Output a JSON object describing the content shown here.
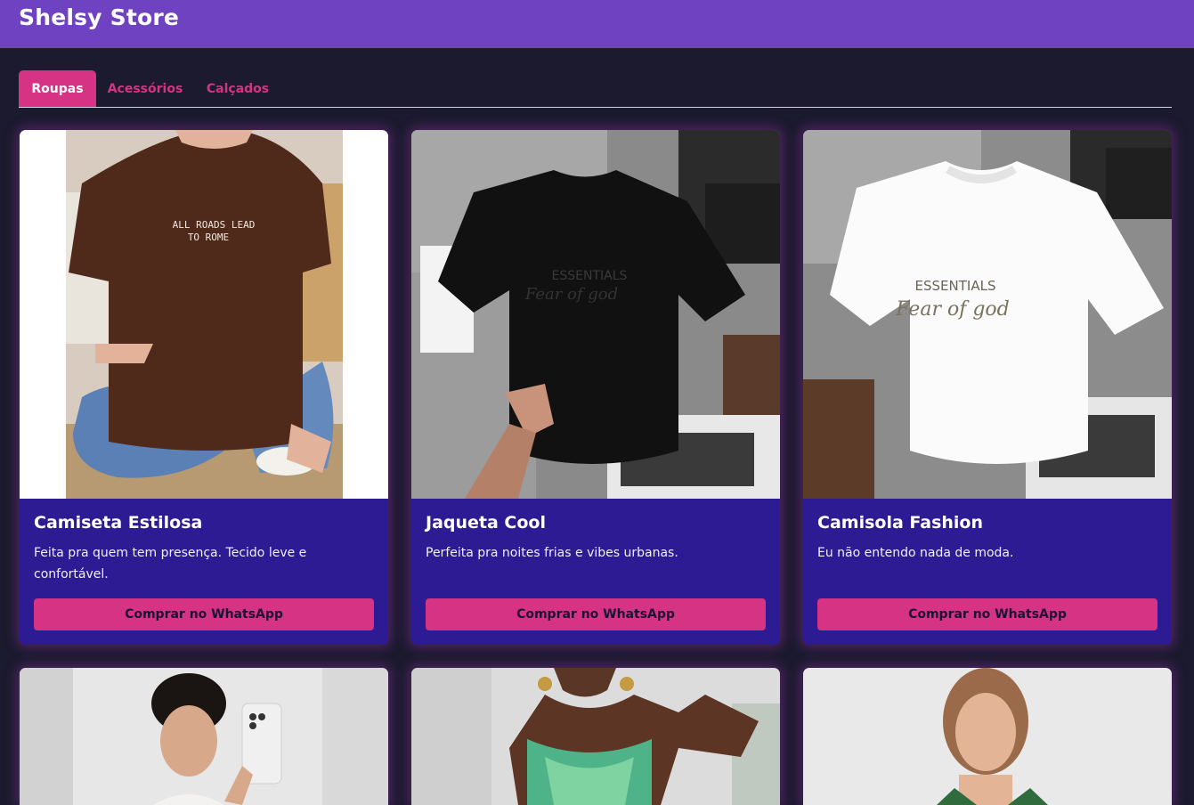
{
  "store": {
    "name": "Shelsy Store"
  },
  "tabs": [
    {
      "label": "Roupas",
      "active": true
    },
    {
      "label": "Acessórios",
      "active": false
    },
    {
      "label": "Calçados",
      "active": false
    }
  ],
  "products": [
    {
      "name": "Camiseta Estilosa",
      "description": "Feita pra quem tem presença. Tecido leve e confortável.",
      "button_label": "Comprar no WhatsApp",
      "image": "brown-oversized-tshirt-photo",
      "shirt_text": [
        "ALL ROADS LEAD",
        "TO ROME"
      ]
    },
    {
      "name": "Jaqueta Cool",
      "description": "Perfeita pra noites frias e vibes urbanas.",
      "button_label": "Comprar no WhatsApp",
      "image": "black-essentials-tshirt-photo",
      "shirt_text": [
        "ESSENTIALS",
        "Fear of god"
      ]
    },
    {
      "name": "Camisola Fashion",
      "description": "Eu não entendo nada de moda.",
      "button_label": "Comprar no WhatsApp",
      "image": "white-essentials-tshirt-photo",
      "shirt_text": [
        "ESSENTIALS",
        "Fear of god"
      ]
    },
    {
      "image": "woman-selfie-phone-photo"
    },
    {
      "image": "woman-green-tiedye-top-photo"
    },
    {
      "image": "woman-green-floral-top-photo"
    }
  ],
  "colors": {
    "header": "#6f42c1",
    "background": "#1b1a2e",
    "card": "#2d1b94",
    "accent": "#d63384"
  }
}
